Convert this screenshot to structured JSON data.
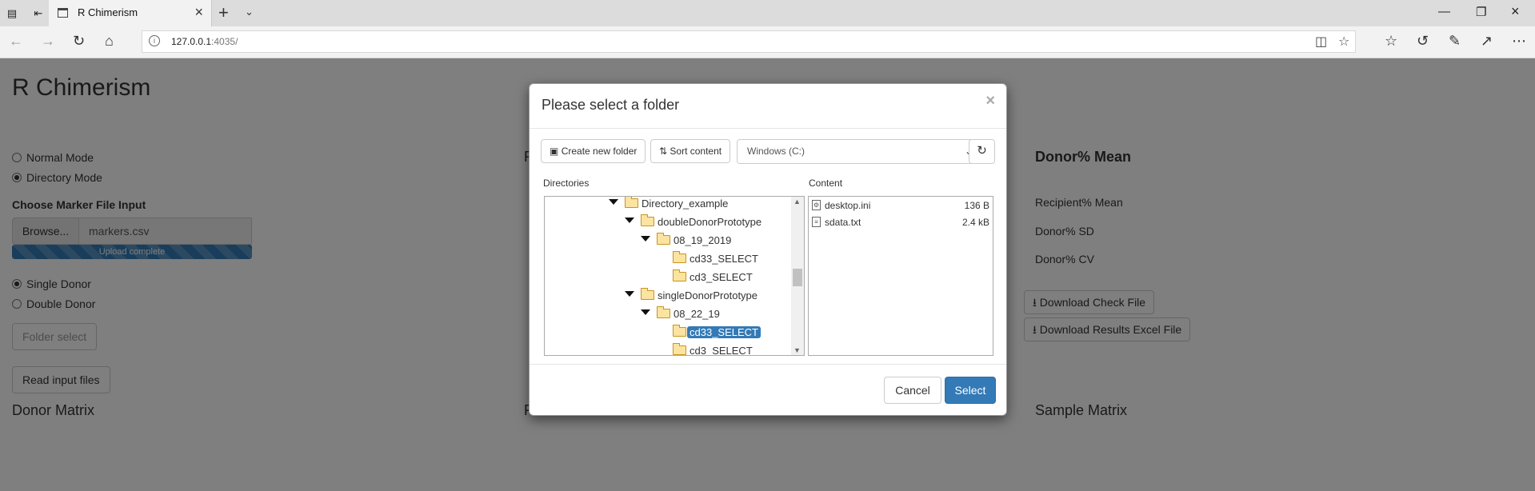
{
  "browser": {
    "tab_title": "R Chimerism",
    "url_host": "127.0.0.1",
    "url_rest": ":4035/"
  },
  "page": {
    "app_title": "R Chimerism",
    "mode_options": [
      {
        "label": "Normal Mode",
        "selected": false
      },
      {
        "label": "Directory Mode",
        "selected": true
      }
    ],
    "marker_label": "Choose Marker File Input",
    "browse_label": "Browse...",
    "marker_file": "markers.csv",
    "upload_status": "Upload complete",
    "upload_progress_pct": 100,
    "donor_options": [
      {
        "label": "Single Donor",
        "selected": true
      },
      {
        "label": "Double Donor",
        "selected": false
      }
    ],
    "folder_select_label": "Folder select",
    "read_input_label": "Read input files",
    "donor_matrix_title": "Donor Matrix",
    "middle_heading_partial": "R",
    "middle_bottom_partial": "R",
    "sample_matrix_title": "Sample Matrix",
    "donor_mean_title": "Donor% Mean",
    "stats": [
      "Recipient% Mean",
      "Donor% SD",
      "Donor% CV"
    ],
    "download_check_label": "Download Check File",
    "download_results_label": "Download Results Excel File"
  },
  "modal": {
    "title": "Please select a folder",
    "close": "×",
    "create_folder_label": "Create new folder",
    "sort_label": "Sort content",
    "drive_value": "Windows (C:)",
    "directories_head": "Directories",
    "content_head": "Content",
    "tree": [
      {
        "name": "Directory_example",
        "depth": 0,
        "expanded": true,
        "selected": false
      },
      {
        "name": "doubleDonorPrototype",
        "depth": 1,
        "expanded": true,
        "selected": false
      },
      {
        "name": "08_19_2019",
        "depth": 2,
        "expanded": true,
        "selected": false
      },
      {
        "name": "cd33_SELECT",
        "depth": 3,
        "expanded": false,
        "selected": false
      },
      {
        "name": "cd3_SELECT",
        "depth": 3,
        "expanded": false,
        "selected": false
      },
      {
        "name": "singleDonorPrototype",
        "depth": 1,
        "expanded": true,
        "selected": false
      },
      {
        "name": "08_22_19",
        "depth": 2,
        "expanded": true,
        "selected": false
      },
      {
        "name": "cd33_SELECT",
        "depth": 3,
        "expanded": false,
        "selected": true
      },
      {
        "name": "cd3_SELECT",
        "depth": 3,
        "expanded": false,
        "selected": false
      }
    ],
    "files": [
      {
        "name": "desktop.ini",
        "size": "136 B",
        "icon": "settings-file-icon"
      },
      {
        "name": "sdata.txt",
        "size": "2.4 kB",
        "icon": "text-file-icon"
      }
    ],
    "cancel_label": "Cancel",
    "select_label": "Select"
  },
  "colors": {
    "primary": "#337ab7",
    "overlay": "rgba(0,0,0,0.5)",
    "folder": "#fbe3a0"
  }
}
